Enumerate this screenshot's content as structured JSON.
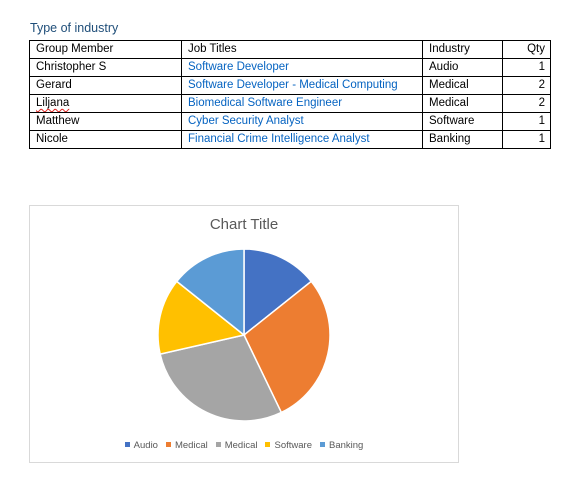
{
  "heading": "Type of industry",
  "table": {
    "headers": [
      "Group Member",
      "Job Titles",
      "Industry",
      "Qty"
    ],
    "rows": [
      [
        "Christopher S",
        "Software Developer",
        "Audio",
        "1"
      ],
      [
        "Gerard",
        "Software Developer - Medical Computing",
        "Medical",
        "2"
      ],
      [
        "Liljana",
        "Biomedical Software Engineer",
        "Medical",
        "2"
      ],
      [
        "Matthew",
        "Cyber Security Analyst",
        "Software",
        "1"
      ],
      [
        "Nicole",
        "Financial Crime Intelligence Analyst",
        "Banking",
        "1"
      ]
    ]
  },
  "chart_data": {
    "type": "pie",
    "title": "Chart Title",
    "categories": [
      "Audio",
      "Medical",
      "Medical",
      "Software",
      "Banking"
    ],
    "values": [
      1,
      2,
      2,
      1,
      1
    ],
    "colors": [
      "#4472c4",
      "#ed7d31",
      "#a5a5a5",
      "#ffc000",
      "#5b9bd5"
    ],
    "legend_position": "bottom"
  }
}
